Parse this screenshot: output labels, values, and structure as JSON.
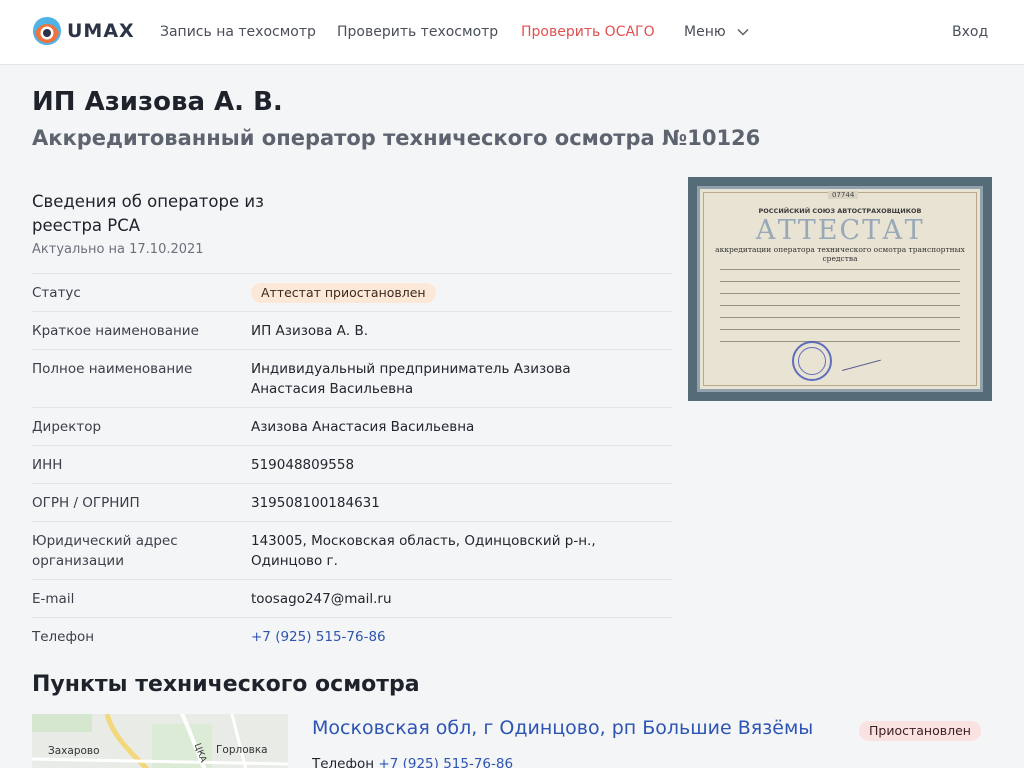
{
  "header": {
    "brand": "UMAX",
    "nav": [
      "Запись на техосмотр",
      "Проверить техосмотр",
      "Проверить ОСАГО"
    ],
    "menu_label": "Меню",
    "login_label": "Вход",
    "colors": {
      "accent_red": "#e05050",
      "link_blue": "#2e55b3"
    }
  },
  "page": {
    "title": "ИП Азизова А. В.",
    "subtitle": "Аккредитованный оператор технического осмотра №10126"
  },
  "registry": {
    "title": "Сведения об операторе из реестра РСА",
    "date": "Актуально на 17.10.2021",
    "rows": [
      {
        "label": "Статус",
        "value": "Аттестат приостановлен"
      },
      {
        "label": "Краткое наименование",
        "value": "ИП Азизова А. В."
      },
      {
        "label": "Полное наименование",
        "value": "Индивидуальный предприниматель Азизова Анастасия Васильевна"
      },
      {
        "label": "Директор",
        "value": "Азизова Анастасия Васильевна"
      },
      {
        "label": "ИНН",
        "value": "519048809558"
      },
      {
        "label": "ОГРН / ОГРНИП",
        "value": "319508100184631"
      },
      {
        "label": "Юридический адрес организации",
        "value": "143005, Московская область, Одинцовский р-н., Одинцово г."
      },
      {
        "label": "E-mail",
        "value": "toosago247@mail.ru"
      },
      {
        "label": "Телефон",
        "value": "+7 (925) 515-76-86"
      }
    ]
  },
  "certificate": {
    "number": "07744",
    "org": "РОССИЙСКИЙ СОЮЗ АВТОСТРАХОВЩИКОВ",
    "heading": "АТТЕСТАТ",
    "subheading": "аккредитации оператора технического осмотра транспортных средства"
  },
  "points": {
    "title": "Пункты технического осмотра",
    "map_labels": [
      "Захарово",
      "Горловка",
      "ЦКА"
    ],
    "items": [
      {
        "address": "Московская обл, г Одинцово, рп Большие Вязёмы",
        "status": "Приостановлен",
        "phone_label": "Телефон",
        "phone": "+7 (925) 515-76-86"
      }
    ]
  }
}
